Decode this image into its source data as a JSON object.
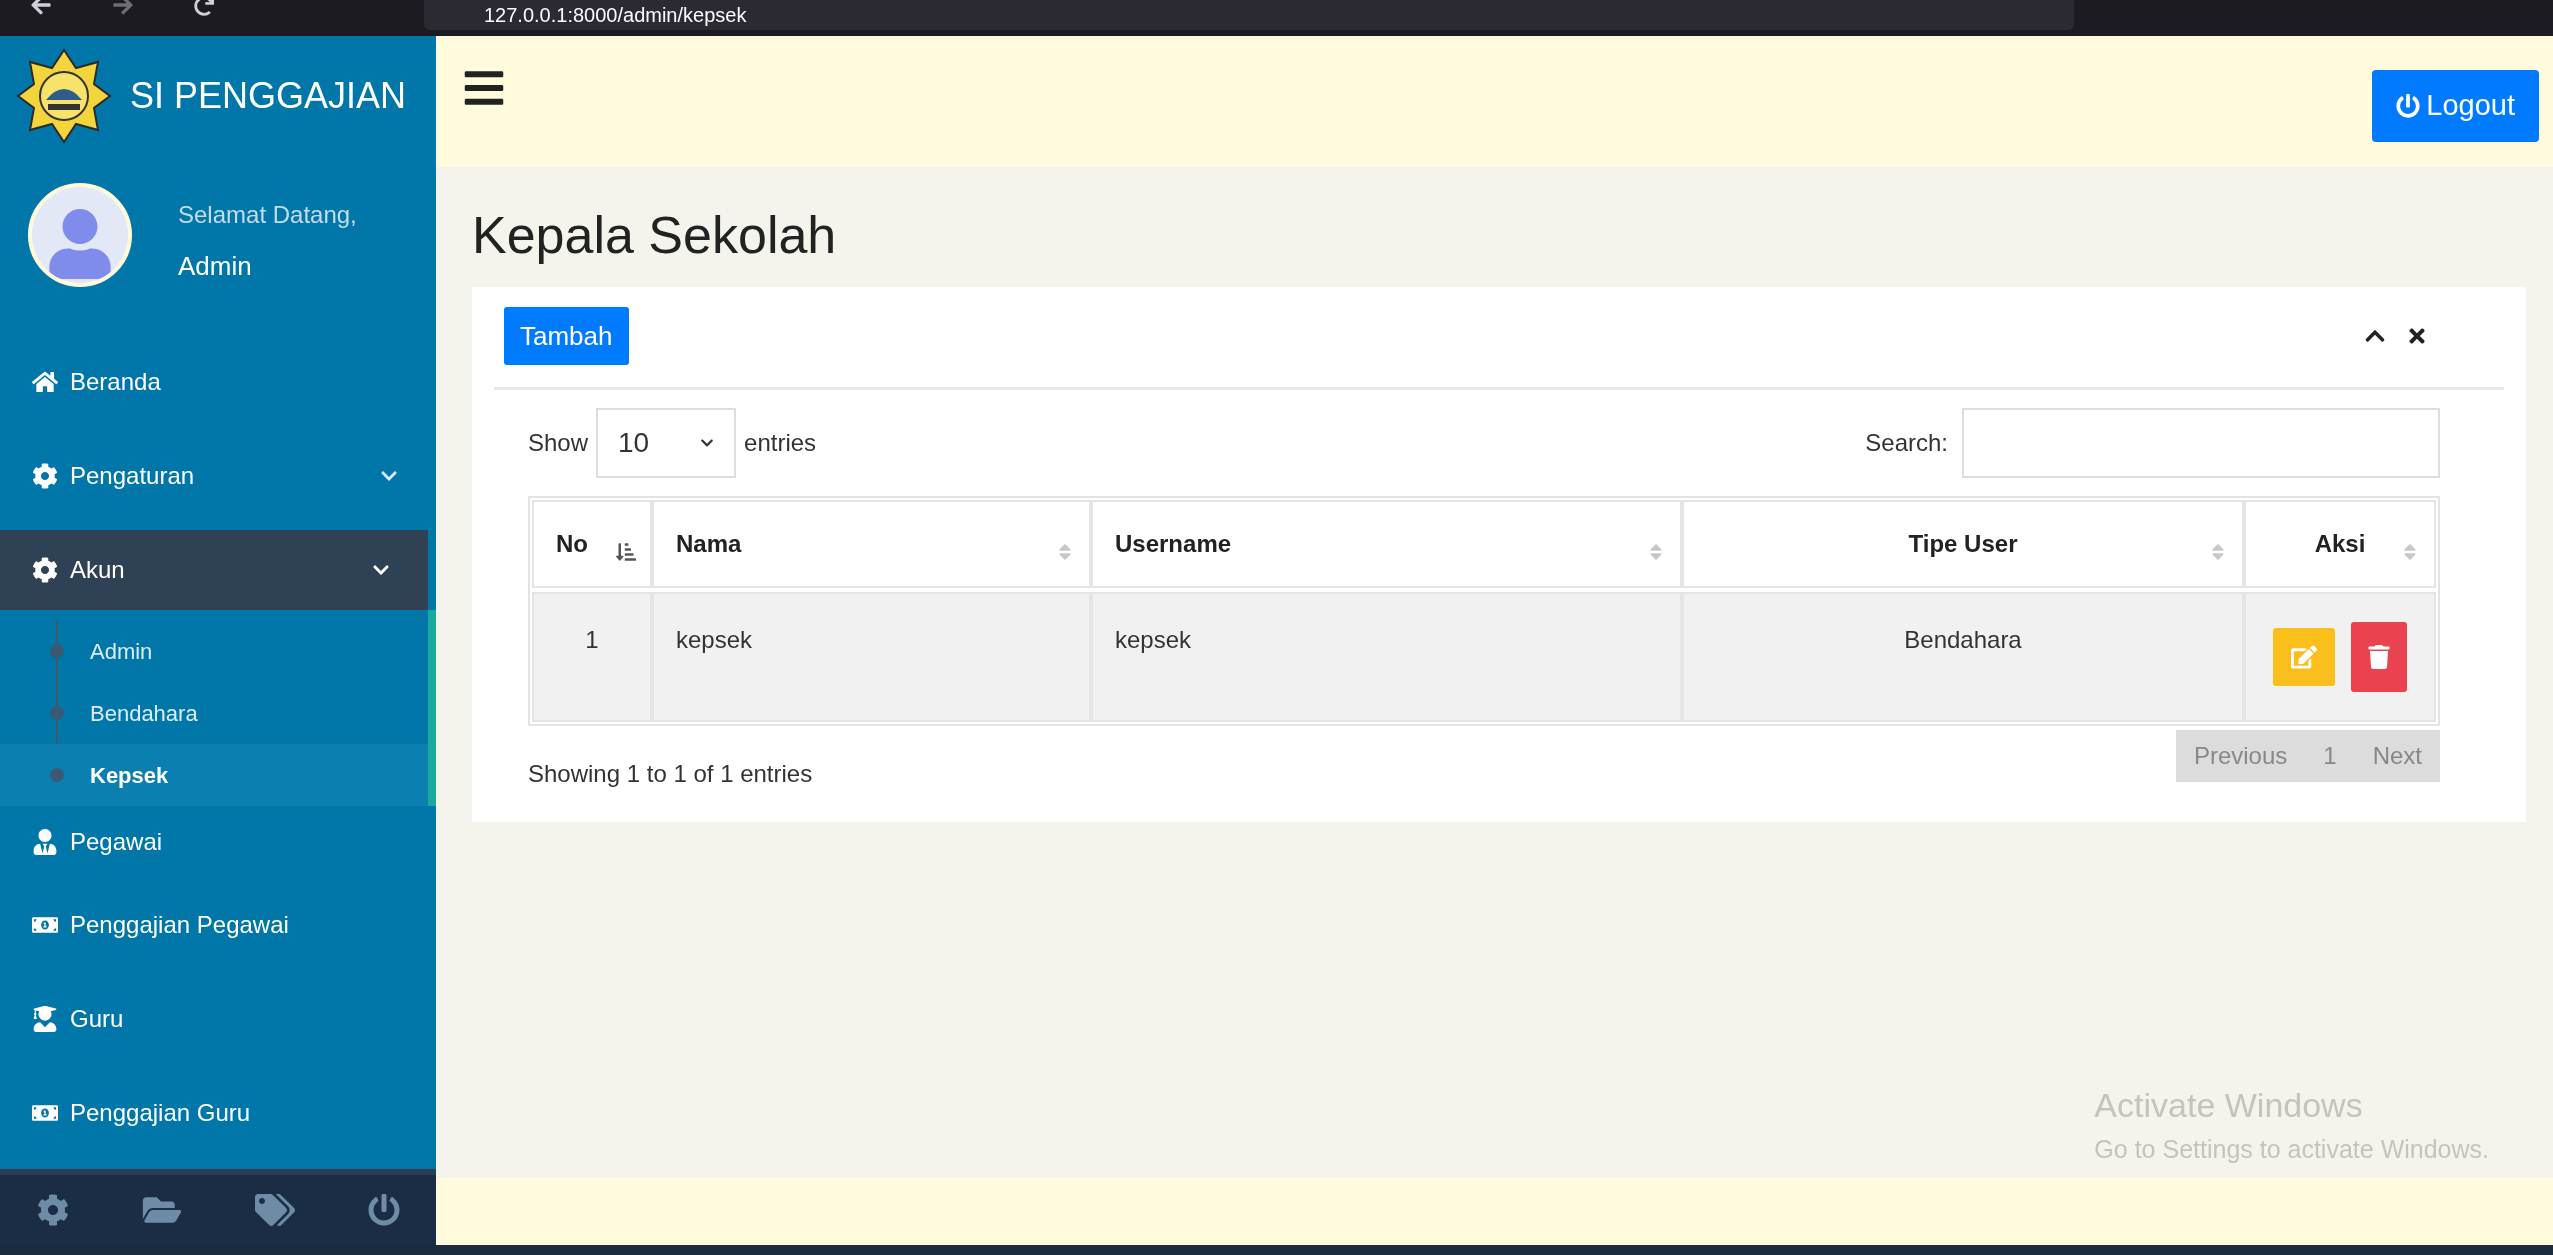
{
  "browser": {
    "url": "127.0.0.1:8000/admin/kepsek"
  },
  "sidebar": {
    "brand": "SI PENGGAJIAN",
    "welcome": "Selamat Datang,",
    "user_name": "Admin",
    "menu": [
      {
        "label": "Beranda",
        "selected": false
      },
      {
        "label": "Pengaturan",
        "selected": false,
        "expanded": false
      },
      {
        "label": "Akun",
        "selected": true,
        "expanded": true,
        "children": [
          {
            "label": "Admin",
            "selected": false
          },
          {
            "label": "Bendahara",
            "selected": false
          },
          {
            "label": "Kepsek",
            "selected": true
          }
        ]
      },
      {
        "label": "Pegawai",
        "selected": false
      },
      {
        "label": "Penggajian Pegawai",
        "selected": false
      },
      {
        "label": "Guru",
        "selected": false
      },
      {
        "label": "Penggajian Guru",
        "selected": false
      }
    ]
  },
  "header": {
    "logout": "Logout"
  },
  "page_title": "Kepala Sekolah",
  "card": {
    "add_button": "Tambah",
    "length": {
      "show": "Show",
      "value": "10",
      "entries": "entries"
    },
    "search": {
      "label": "Search:"
    },
    "table": {
      "columns": [
        {
          "label": "No",
          "sorted": true
        },
        {
          "label": "Nama",
          "sorted": false
        },
        {
          "label": "Username",
          "sorted": false
        },
        {
          "label": "Tipe User",
          "sorted": false
        },
        {
          "label": "Aksi",
          "sorted": false
        }
      ],
      "rows": [
        {
          "cells": [
            "1",
            "kepsek",
            "kepsek",
            "Bendahara"
          ]
        }
      ]
    },
    "info": "Showing 1 to 1 of 1 entries",
    "pagination": {
      "previous": "Previous",
      "page": "1",
      "next": "Next"
    }
  },
  "os_notice": {
    "title": "Activate Windows",
    "text": "Go to Settings to activate Windows."
  }
}
